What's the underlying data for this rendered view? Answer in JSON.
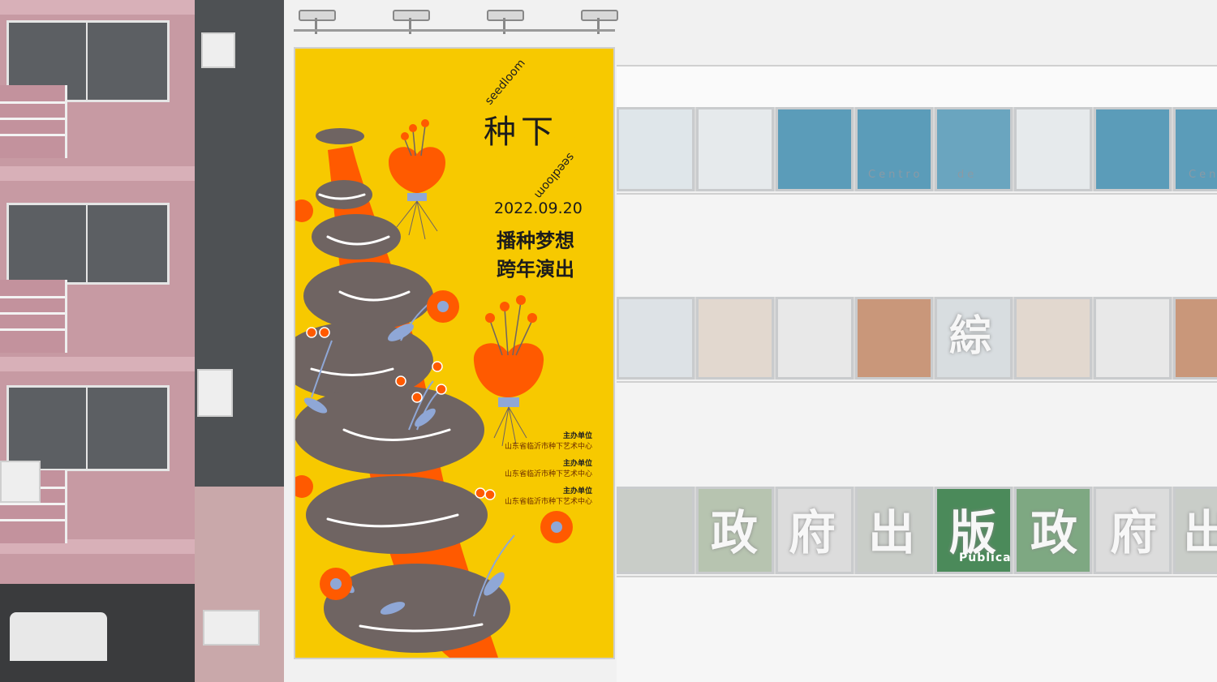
{
  "billboard": {
    "title_cn": "种下",
    "ring_text": "seedloom",
    "date": "2022.09.20",
    "slogan_line1": "播种梦想",
    "slogan_line2": "跨年演出",
    "organizers": [
      {
        "heading": "主办单位",
        "name": "山东省临沂市种下艺术中心"
      },
      {
        "heading": "主办单位",
        "name": "山东省临沂市种下艺术中心"
      },
      {
        "heading": "主办单位",
        "name": "山东省临沂市种下艺术中心"
      }
    ],
    "colors": {
      "background": "#f7c900",
      "orange": "#ff5a00",
      "brown": "#6f6462",
      "blue": "#8fa7d6"
    }
  },
  "building_signage": {
    "centro": "Centro",
    "de": "de",
    "cen": "Cen",
    "zong": "綜",
    "chars": [
      "政",
      "府",
      "出",
      "版",
      "政",
      "府",
      "出"
    ],
    "publica": "Publica"
  }
}
